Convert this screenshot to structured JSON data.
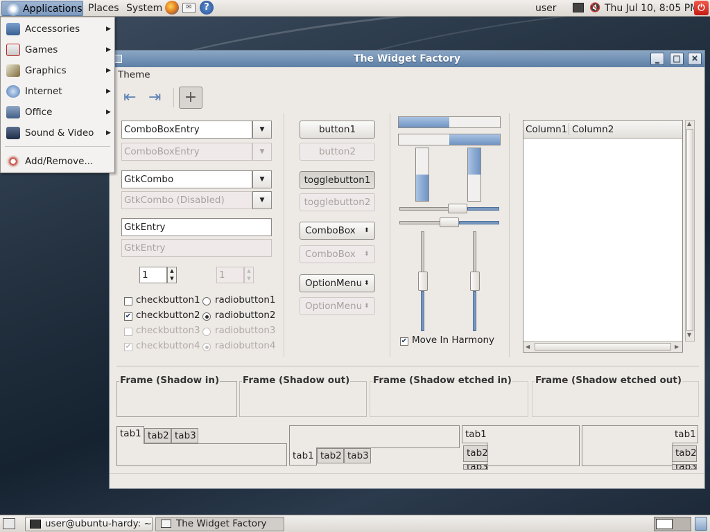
{
  "top_panel": {
    "menus": [
      "Applications",
      "Places",
      "System"
    ],
    "user": "user",
    "clock": "Thu Jul 10,  8:05 PM",
    "launcher_icons": [
      "firefox-icon",
      "mail-icon",
      "help-icon"
    ]
  },
  "apps_menu": {
    "items": [
      {
        "label": "Accessories",
        "icon": "accessories-icon",
        "submenu": true
      },
      {
        "label": "Games",
        "icon": "games-icon",
        "submenu": true
      },
      {
        "label": "Graphics",
        "icon": "graphics-icon",
        "submenu": true
      },
      {
        "label": "Internet",
        "icon": "internet-icon",
        "submenu": true
      },
      {
        "label": "Office",
        "icon": "office-icon",
        "submenu": true
      },
      {
        "label": "Sound & Video",
        "icon": "sound-video-icon",
        "submenu": true
      },
      {
        "label": "Add/Remove...",
        "icon": "add-remove-icon",
        "submenu": false
      }
    ]
  },
  "window": {
    "title": "The Widget Factory",
    "menu": "Theme",
    "col1": {
      "combobox_entry": "ComboBoxEntry",
      "combobox_entry_disabled": "ComboBoxEntry",
      "gtkcombo": "GtkCombo",
      "gtkcombo_disabled": "GtkCombo (Disabled)",
      "gtkentry": "GtkEntry",
      "gtkentry_disabled": "GtkEntry",
      "spin1": "1",
      "spin2": "1",
      "checks": [
        {
          "label": "checkbutton1",
          "checked": false,
          "disabled": false
        },
        {
          "label": "checkbutton2",
          "checked": true,
          "disabled": false
        },
        {
          "label": "checkbutton3",
          "checked": false,
          "disabled": true
        },
        {
          "label": "checkbutton4",
          "checked": true,
          "disabled": true
        }
      ],
      "radios": [
        {
          "label": "radiobutton1",
          "selected": false,
          "disabled": false
        },
        {
          "label": "radiobutton2",
          "selected": true,
          "disabled": false
        },
        {
          "label": "radiobutton3",
          "selected": false,
          "disabled": true
        },
        {
          "label": "radiobutton4",
          "selected": true,
          "disabled": true
        }
      ]
    },
    "col2": {
      "button1": "button1",
      "button2": "button2",
      "togglebutton1": "togglebutton1",
      "togglebutton2": "togglebutton2",
      "combobox": "ComboBox",
      "combobox_disabled": "ComboBox",
      "optionmenu": "OptionMenu",
      "optionmenu_disabled": "OptionMenu"
    },
    "col3": {
      "hprogress1": 0.5,
      "hprogress2": 0.5,
      "vprogress1": 0.5,
      "vprogress2": 0.5,
      "hscale1": 0.6,
      "hscale2": 0.5,
      "vscale1": 0.5,
      "vscale2": 0.5,
      "move_in_harmony": "Move In Harmony",
      "move_in_harmony_checked": true
    },
    "treeview": {
      "columns": [
        "Column1",
        "Column2"
      ],
      "rows": []
    },
    "frames": [
      "Frame (Shadow in)",
      "Frame (Shadow out)",
      "Frame (Shadow etched in)",
      "Frame (Shadow etched out)"
    ],
    "notebooks": {
      "tabs": [
        "tab1",
        "tab2",
        "tab3"
      ]
    }
  },
  "taskbar": {
    "tasks": [
      "user@ubuntu-hardy: ~",
      "The Widget Factory"
    ]
  },
  "colors": {
    "accent": "#7898c0",
    "panel": "#e6e2dd",
    "progress": "#8aaad2"
  }
}
